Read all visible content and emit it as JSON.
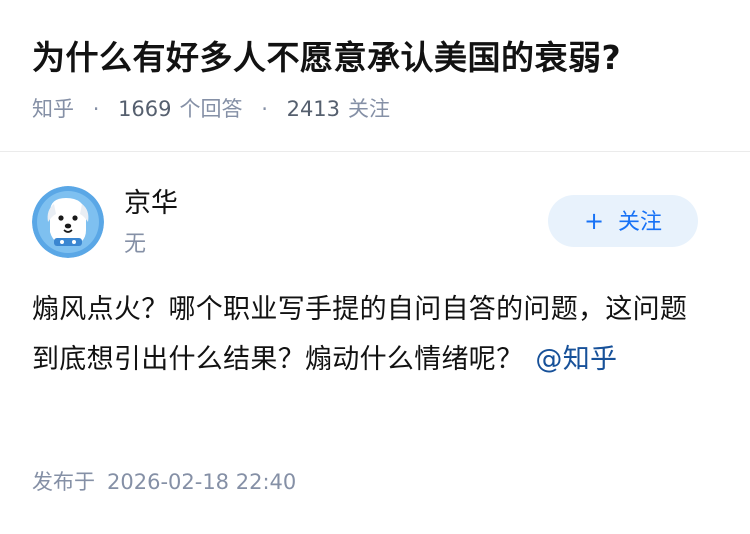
{
  "question": {
    "title": "为什么有好多人不愿意承认美国的衰弱?",
    "source": "知乎",
    "separator": "·",
    "answer_count": "1669",
    "answer_label": "个回答",
    "follower_count": "2413",
    "follower_label": "关注"
  },
  "answer": {
    "author": {
      "name": "京华",
      "headline": "无",
      "avatar_icon": "cartoon-dog-avatar-icon"
    },
    "follow_button": {
      "icon": "+",
      "label": "关注"
    },
    "content": "煽风点火？哪个职业写手提的自问自答的问题，这问题到底想引出什么结果？煽动什么情绪呢？",
    "mention": "@知乎",
    "publish_label": "发布于",
    "publish_time": "2026-02-18 22:40"
  },
  "colors": {
    "title": "#121212",
    "meta": "#8590a6",
    "accent": "#1772f6",
    "follow_bg": "#e8f2fc",
    "mention": "#175199"
  }
}
